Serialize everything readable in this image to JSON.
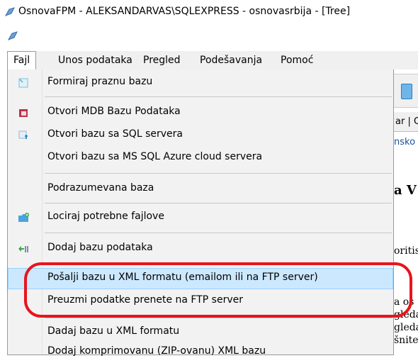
{
  "window": {
    "title": "OsnovaFPM - ALEKSANDARVAS\\SQLEXPRESS - osnovasrbija - [Tree]"
  },
  "menubar": {
    "items": [
      {
        "label": "Fajl",
        "active": true
      },
      {
        "label": "Unos podataka"
      },
      {
        "label": "Pregled"
      },
      {
        "label": "Podešavanja"
      },
      {
        "label": "Pomoć"
      }
    ]
  },
  "dropdown": {
    "items": [
      {
        "label": "Formiraj praznu bazu",
        "icon": "new-database-icon"
      },
      {
        "label": "Otvori MDB Bazu Podataka",
        "icon": "access-database-icon"
      },
      {
        "label": "Otvori bazu sa SQL servera",
        "icon": "sql-server-icon"
      },
      {
        "label": "Otvori bazu sa MS SQL Azure cloud servera"
      },
      {
        "label": "Podrazumevana baza"
      },
      {
        "label": "Lociraj potrebne fajlove",
        "icon": "locate-folder-icon"
      },
      {
        "label": "Dodaj bazu podataka",
        "icon": "add-database-icon"
      },
      {
        "label": "Pošalji bazu u XML formatu (emailom ili na FTP server)",
        "hover": true
      },
      {
        "label": "Preuzmi podatke prenete na FTP server"
      },
      {
        "label": "Dadaj bazu  u XML formatu"
      },
      {
        "label": "Dodaj komprimovanu (ZIP-ovanu) XML bazu"
      }
    ]
  },
  "background": {
    "tab_fragment": "ar | C",
    "link_fragment": "nsko",
    "heading_fragment": "a V",
    "text_fragments": [
      "oritis",
      "a os",
      "gleda",
      "gleda",
      "šnite"
    ]
  },
  "colors": {
    "menu_bg": "#f2f2f2",
    "hover_bg": "#cce8ff",
    "annotation_ring": "#e8141c"
  }
}
